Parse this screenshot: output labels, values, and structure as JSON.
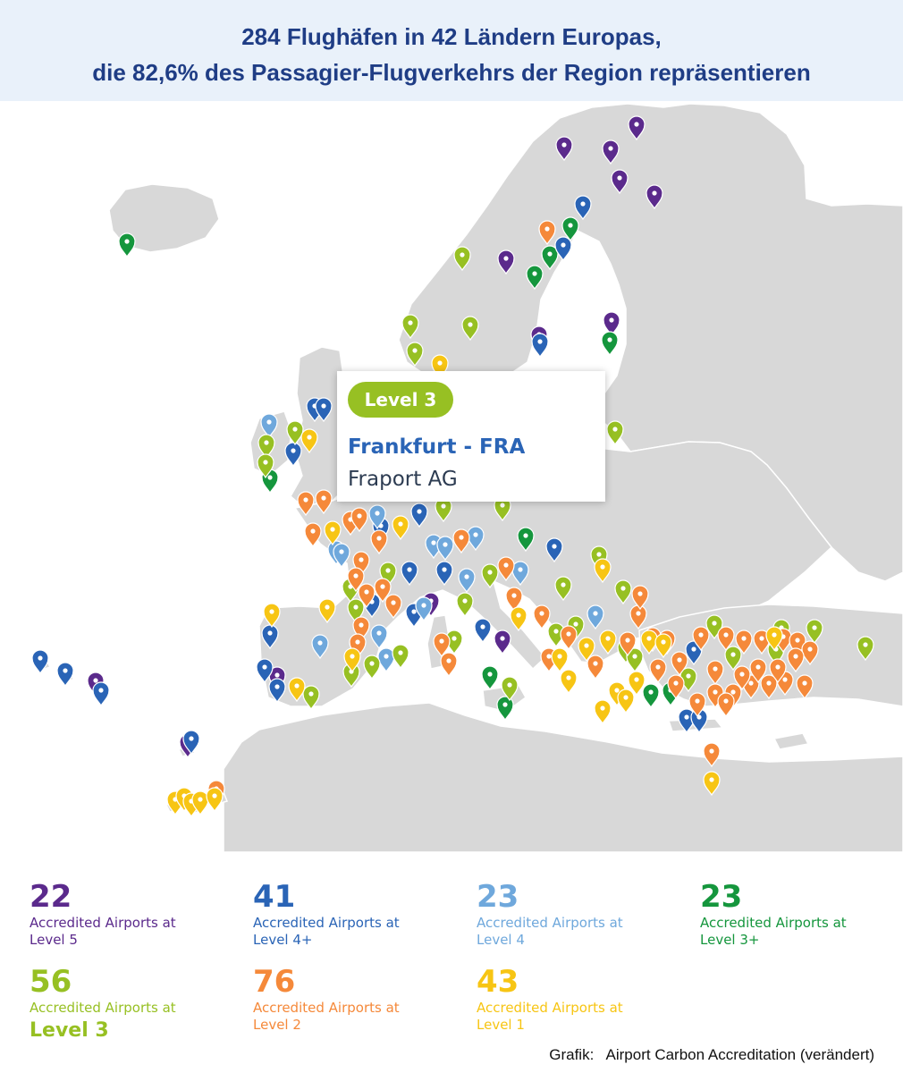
{
  "title": {
    "line1": "284 Flughäfen in 42 Ländern Europas,",
    "line2": "die 82,6% des Passagier-Flugverkehrs der Region repräsentieren"
  },
  "colors": {
    "map_background": "#ffffff",
    "land": "#d8d8d8",
    "borders": "#ffffff",
    "title_background": "#e9f1fa",
    "title_text": "#1f3d85"
  },
  "tooltip": {
    "level_badge": "Level 3",
    "airport": "Frankfurt - FRA",
    "operator": "Fraport AG",
    "badge_color": "#97c023"
  },
  "legend": [
    {
      "count": "22",
      "desc1": "Accredited Airports at",
      "desc2": "Level 5",
      "color": "#5b2a8c"
    },
    {
      "count": "41",
      "desc1": "Accredited Airports at",
      "desc2": "Level 4+",
      "color": "#2a64b6"
    },
    {
      "count": "23",
      "desc1": "Accredited Airports at",
      "desc2": "Level 4",
      "color": "#6fa8dc"
    },
    {
      "count": "23",
      "desc1": "Accredited Airports at",
      "desc2": "Level 3+",
      "color": "#15963d"
    },
    {
      "count": "56",
      "desc1": "Accredited Airports at",
      "desc2": "Level 3",
      "color": "#97c023"
    },
    {
      "count": "76",
      "desc1": "Accredited Airports at",
      "desc2": "Level 2",
      "color": "#f5893a"
    },
    {
      "count": "43",
      "desc1": "Accredited Airports at",
      "desc2": "Level 1",
      "color": "#f7c514"
    }
  ],
  "credit": "Grafik:   Airport Carbon Accreditation (verändert)"
}
